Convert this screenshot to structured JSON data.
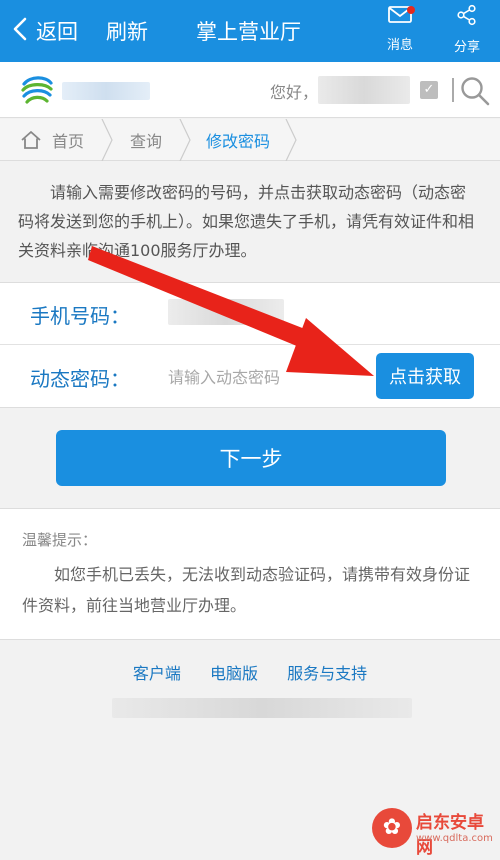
{
  "topbar": {
    "back_label": "返回",
    "refresh_label": "刷新",
    "title": "掌上营业厅",
    "messages_label": "消息",
    "share_label": "分享",
    "color": "#1a8fe0"
  },
  "header": {
    "greeting": "您好，"
  },
  "breadcrumb": {
    "home": "首页",
    "query": "查询",
    "current": "修改密码"
  },
  "intro": {
    "text": "请输入需要修改密码的号码，并点击获取动态密码（动态密码将发送到您的手机上）。如果您遗失了手机，请凭有效证件和相关资料亲临沟通100服务厅办理。"
  },
  "form": {
    "phone_label": "手机号码：",
    "otp_label": "动态密码：",
    "otp_placeholder": "请输入动态密码",
    "get_code_button": "点击获取"
  },
  "next_button": "下一步",
  "tips": {
    "title": "温馨提示：",
    "body": "如您手机已丢失，无法收到动态验证码，请携带有效身份证件资料，前往当地营业厅办理。"
  },
  "footer": {
    "links": [
      "客户端",
      "电脑版",
      "服务与支持"
    ]
  },
  "watermark": {
    "name": "启东安卓网",
    "url": "www.qdlta.com"
  },
  "colors": {
    "accent": "#1a8fe0",
    "label_blue": "#1a78c2",
    "annotation_red": "#e8231a"
  }
}
